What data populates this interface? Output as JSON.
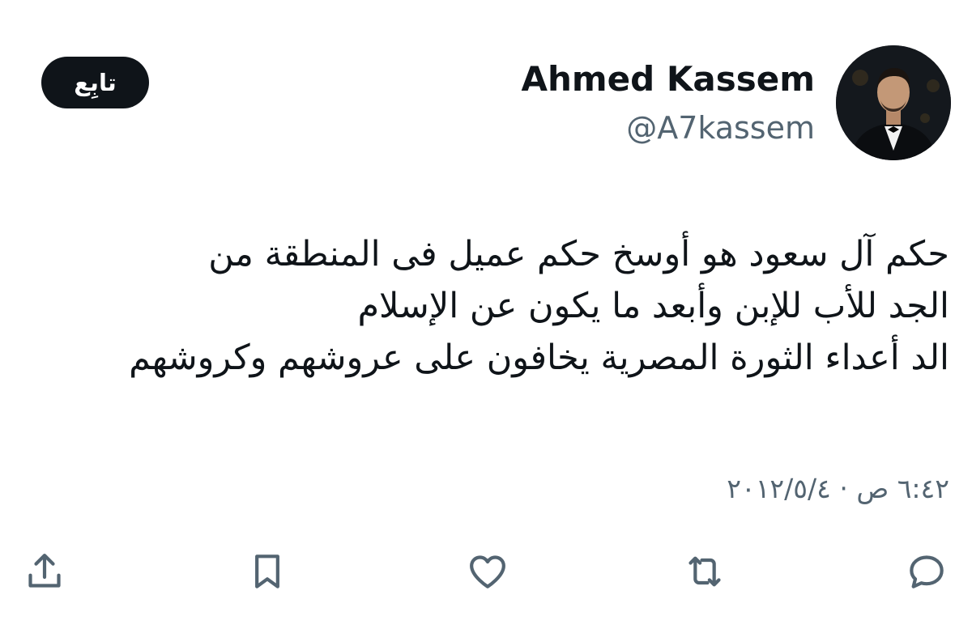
{
  "user": {
    "display_name": "Ahmed Kassem",
    "handle": "@A7kassem",
    "avatar_icon": "profile-photo"
  },
  "follow_button": {
    "label": "تابِع"
  },
  "tweet": {
    "lines": [
      "حكم آل سعود هو أوسخ حكم عميل فى المنطقة من",
      "الجد للأب للإبن وأبعد ما يكون عن الإسلام",
      "الد أعداء الثورة المصرية يخافون على عروشهم وكروشهم"
    ],
    "timestamp": "٦:٤٢ ص · ٢٠١٢/٥/٤"
  },
  "actions": [
    {
      "name": "reply",
      "icon": "speech-bubble-icon"
    },
    {
      "name": "retweet",
      "icon": "retweet-arrows-icon"
    },
    {
      "name": "like",
      "icon": "heart-icon"
    },
    {
      "name": "bookmark",
      "icon": "bookmark-icon"
    },
    {
      "name": "share",
      "icon": "share-upload-icon"
    }
  ],
  "colors": {
    "text_primary": "#0f1419",
    "text_secondary": "#536471",
    "follow_button_bg": "#0f1419",
    "icon_color": "#536471"
  }
}
